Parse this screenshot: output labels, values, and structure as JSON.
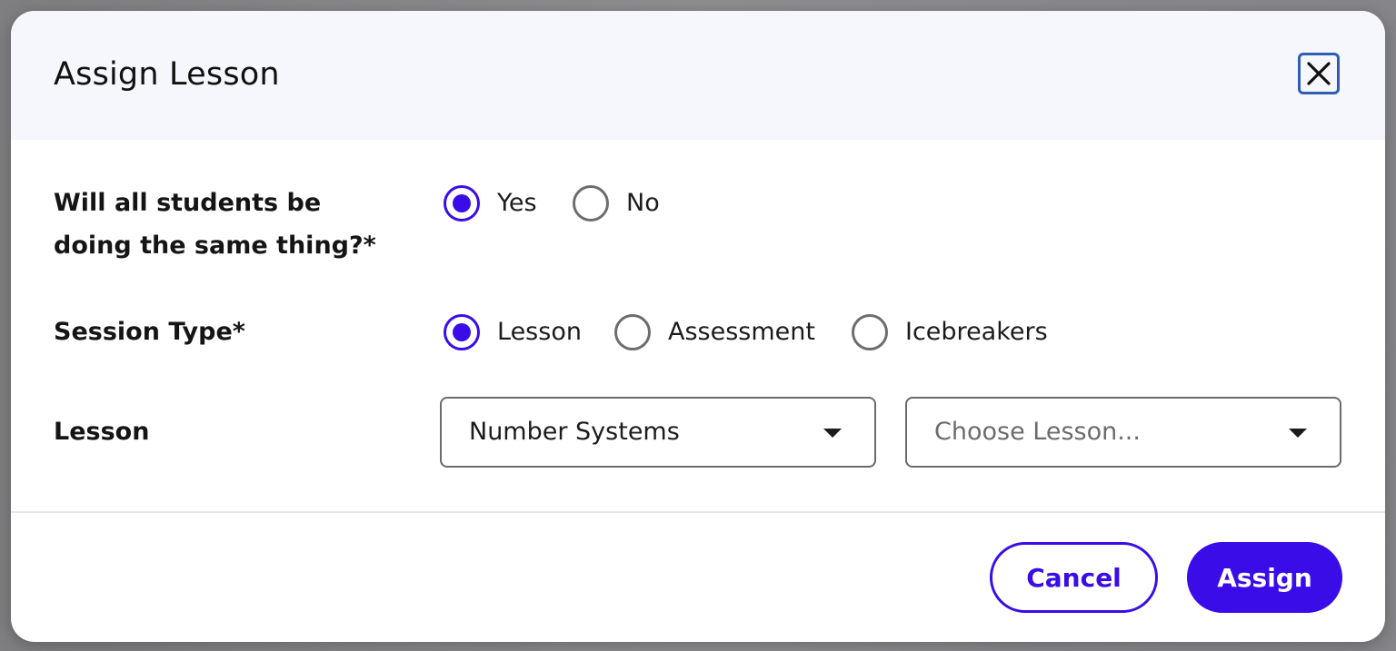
{
  "dialog": {
    "title": "Assign Lesson",
    "close_icon": "close-icon"
  },
  "same_thing": {
    "label": "Will all students be doing the same thing?*",
    "options": [
      {
        "label": "Yes",
        "checked": true
      },
      {
        "label": "No",
        "checked": false
      }
    ]
  },
  "session_type": {
    "label": "Session Type*",
    "options": [
      {
        "label": "Lesson",
        "checked": true
      },
      {
        "label": "Assessment",
        "checked": false
      },
      {
        "label": "Icebreakers",
        "checked": false
      }
    ]
  },
  "lesson": {
    "label": "Lesson",
    "unit_select": {
      "value": "Number Systems",
      "caret_icon": "caret-down-icon"
    },
    "lesson_select": {
      "placeholder": "Choose Lesson...",
      "caret_icon": "caret-down-icon"
    }
  },
  "footer": {
    "cancel_label": "Cancel",
    "assign_label": "Assign"
  },
  "colors": {
    "accent": "#3a0ce8",
    "header_bg": "#f6f7fd",
    "close_border": "#2f5db2",
    "text": "#151515",
    "placeholder": "#6c6c6c"
  }
}
